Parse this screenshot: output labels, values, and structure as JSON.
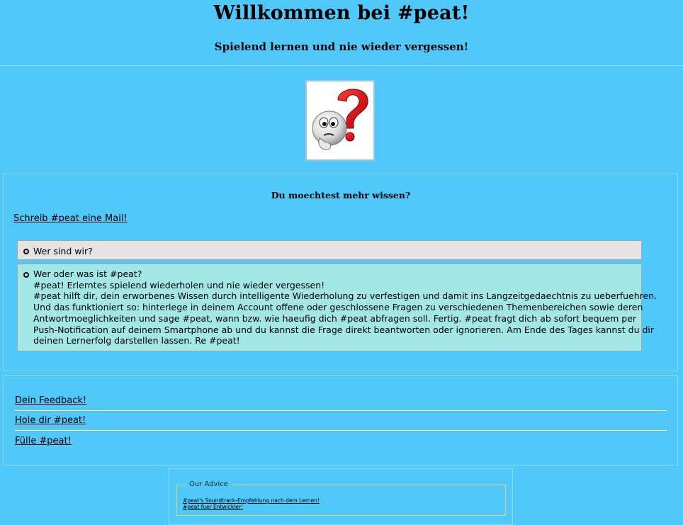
{
  "header": {
    "title": "Willkommen bei #peat!",
    "subtitle": "Spielend lernen und nie wieder vergessen!"
  },
  "logo": {
    "icon": "thinking-face-question-mark-icon"
  },
  "info": {
    "heading": "Du moechtest mehr wissen?",
    "mail_link": "Schreib #peat eine Mail!",
    "accordion": [
      {
        "title": "Wer sind wir?",
        "state": "collapsed"
      },
      {
        "title": "Wer oder was ist #peat?",
        "state": "expanded",
        "lines": [
          "#peat! Erlerntes spielend wiederholen und nie wieder vergessen!",
          "#peat hilft dir, dein erworbenes Wissen durch intelligente Wiederholung zu verfestigen und damit ins Langzeitgedaechtnis zu ueberfuehren.",
          "Und das funktioniert so: hinterlege in deinem Account offene oder geschlossene Fragen zu verschiedenen Themenbereichen sowie deren",
          "Antwortmoeglichkeiten und sage #peat, wann bzw. wie haeufig dich #peat abfragen soll. Fertig. #peat fragt dich ab sofort bequem per",
          "Push-Notification auf deinem Smartphone ab und du kannst die Frage direkt beantworten oder ignorieren. Am Ende des Tages kannst du dir",
          "deinen Lernerfolg darstellen lassen. Re #peat!"
        ]
      }
    ]
  },
  "links": [
    "Dein Feedback!",
    "Hole dir #peat!",
    "Fülle #peat!"
  ],
  "advice": {
    "legend": "Our Advice",
    "items": [
      "#peat's Soundtrack-Empfehlung nach dem Lernen!",
      "#peat fuer Entwickler!"
    ]
  },
  "colors": {
    "background": "#50c8fa",
    "accordion_closed": "#e6e2e2",
    "accordion_open": "#a2e6e6"
  }
}
